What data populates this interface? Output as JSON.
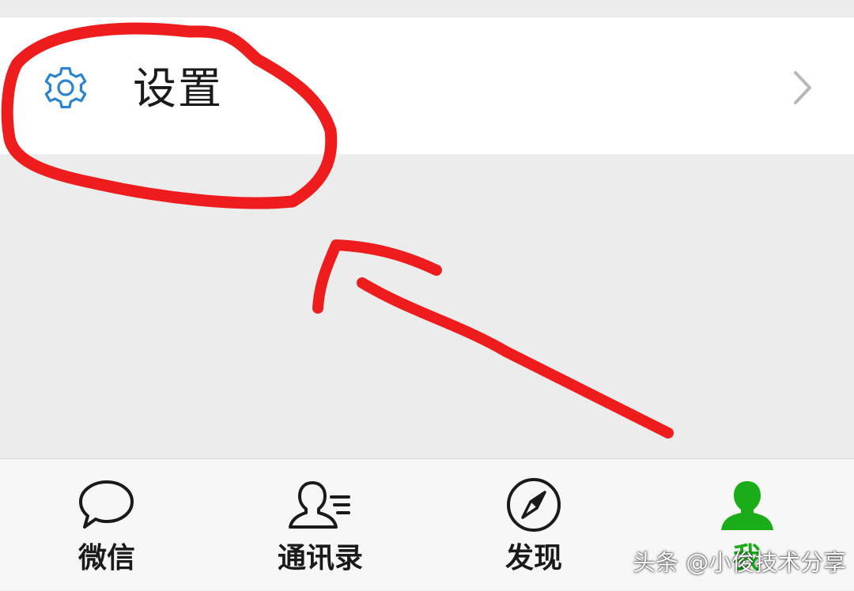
{
  "settings": {
    "label": "设置",
    "icon": "gear-icon",
    "chevron": "chevron-right-icon"
  },
  "tabs": [
    {
      "label": "微信",
      "icon": "chat-bubble-icon",
      "active": false
    },
    {
      "label": "通讯录",
      "icon": "contacts-icon",
      "active": false
    },
    {
      "label": "发现",
      "icon": "compass-icon",
      "active": false
    },
    {
      "label": "我",
      "icon": "person-icon",
      "active": true
    }
  ],
  "watermark": "头条 @小俊技术分享",
  "colors": {
    "accent_green": "#1aad19",
    "gear_blue": "#2a84d2",
    "annotation_red": "#ee1c1c"
  },
  "annotation": {
    "shapes": [
      "hand-drawn-circle-around-settings",
      "hand-drawn-arrow-pointing-to-settings"
    ]
  }
}
